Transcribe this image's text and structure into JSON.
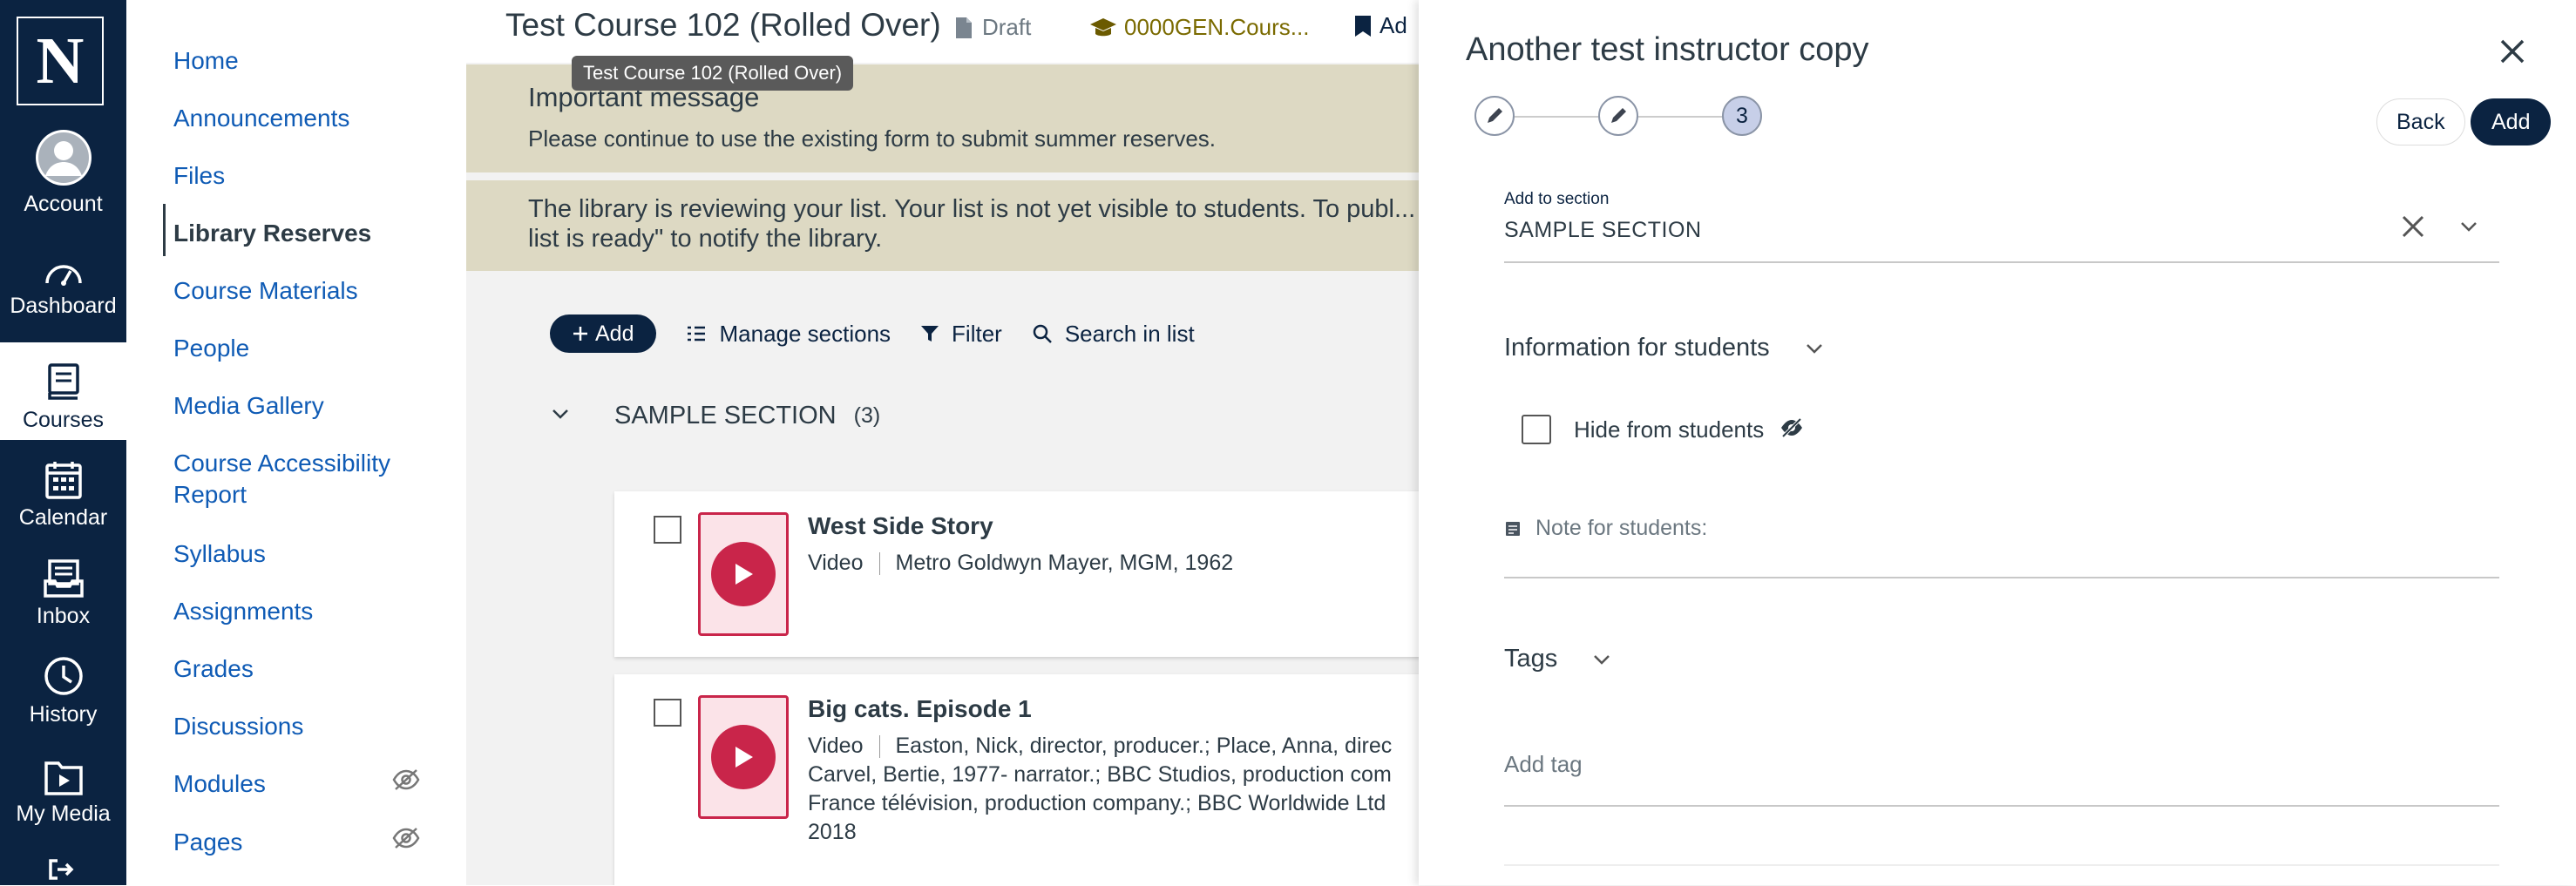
{
  "global_nav": {
    "logo": "N",
    "items": [
      {
        "label": "Account",
        "icon": "account-icon"
      },
      {
        "label": "Dashboard",
        "icon": "dashboard-icon"
      },
      {
        "label": "Courses",
        "icon": "courses-icon",
        "active": true
      },
      {
        "label": "Calendar",
        "icon": "calendar-icon"
      },
      {
        "label": "Inbox",
        "icon": "inbox-icon"
      },
      {
        "label": "History",
        "icon": "history-icon"
      },
      {
        "label": "My Media",
        "icon": "my-media-icon"
      }
    ]
  },
  "course_nav": {
    "items": [
      {
        "label": "Home"
      },
      {
        "label": "Announcements"
      },
      {
        "label": "Files"
      },
      {
        "label": "Library Reserves",
        "active": true
      },
      {
        "label": "Course Materials"
      },
      {
        "label": "People"
      },
      {
        "label": "Media Gallery"
      },
      {
        "label": "Course Accessibility Report"
      },
      {
        "label": "Syllabus"
      },
      {
        "label": "Assignments"
      },
      {
        "label": "Grades"
      },
      {
        "label": "Discussions"
      },
      {
        "label": "Modules",
        "hidden_icon": true
      },
      {
        "label": "Pages",
        "hidden_icon": true
      }
    ]
  },
  "header": {
    "course_title": "Test Course 102 (Rolled Over)",
    "status": "Draft",
    "course_code": "0000GEN.Cours...",
    "add_link": "Ad",
    "tooltip": "Test Course 102 (Rolled Over)"
  },
  "messages": {
    "important_title": "Important message",
    "important_body": "Please continue to use the existing form to submit summer reserves.",
    "review_body": "The library is reviewing your list. Your list is not yet visible to students. To publ... list is ready\" to notify the library."
  },
  "toolbar": {
    "add_label": "Add",
    "manage_label": "Manage sections",
    "filter_label": "Filter",
    "search_label": "Search in list"
  },
  "section": {
    "name": "SAMPLE SECTION",
    "count": "(3)"
  },
  "items": [
    {
      "title": "West Side Story",
      "type": "Video",
      "details": "Metro Goldwyn Mayer, MGM, 1962"
    },
    {
      "title": "Big cats. Episode 1",
      "type": "Video",
      "details_lines": [
        "Easton, Nick, director, producer.; Place, Anna, direc",
        "Carvel, Bertie, 1977- narrator.; BBC Studios, production com",
        "France télévision, production company.; BBC Worldwide Ltd",
        "2018"
      ]
    }
  ],
  "panel": {
    "title": "Another test instructor copy",
    "current_step": "3",
    "back_label": "Back",
    "add_label": "Add",
    "section_field_label": "Add to section",
    "section_field_value": "SAMPLE SECTION",
    "info_heading": "Information for students",
    "hide_label": "Hide from students",
    "note_label": "Note for students:",
    "tags_heading": "Tags",
    "tag_placeholder": "Add tag"
  },
  "colors": {
    "nav_bg": "#0b2341",
    "accent": "#0b2341",
    "link": "#0f5bb5",
    "message_bg": "#ddd9c3",
    "media_red": "#c9254a"
  }
}
